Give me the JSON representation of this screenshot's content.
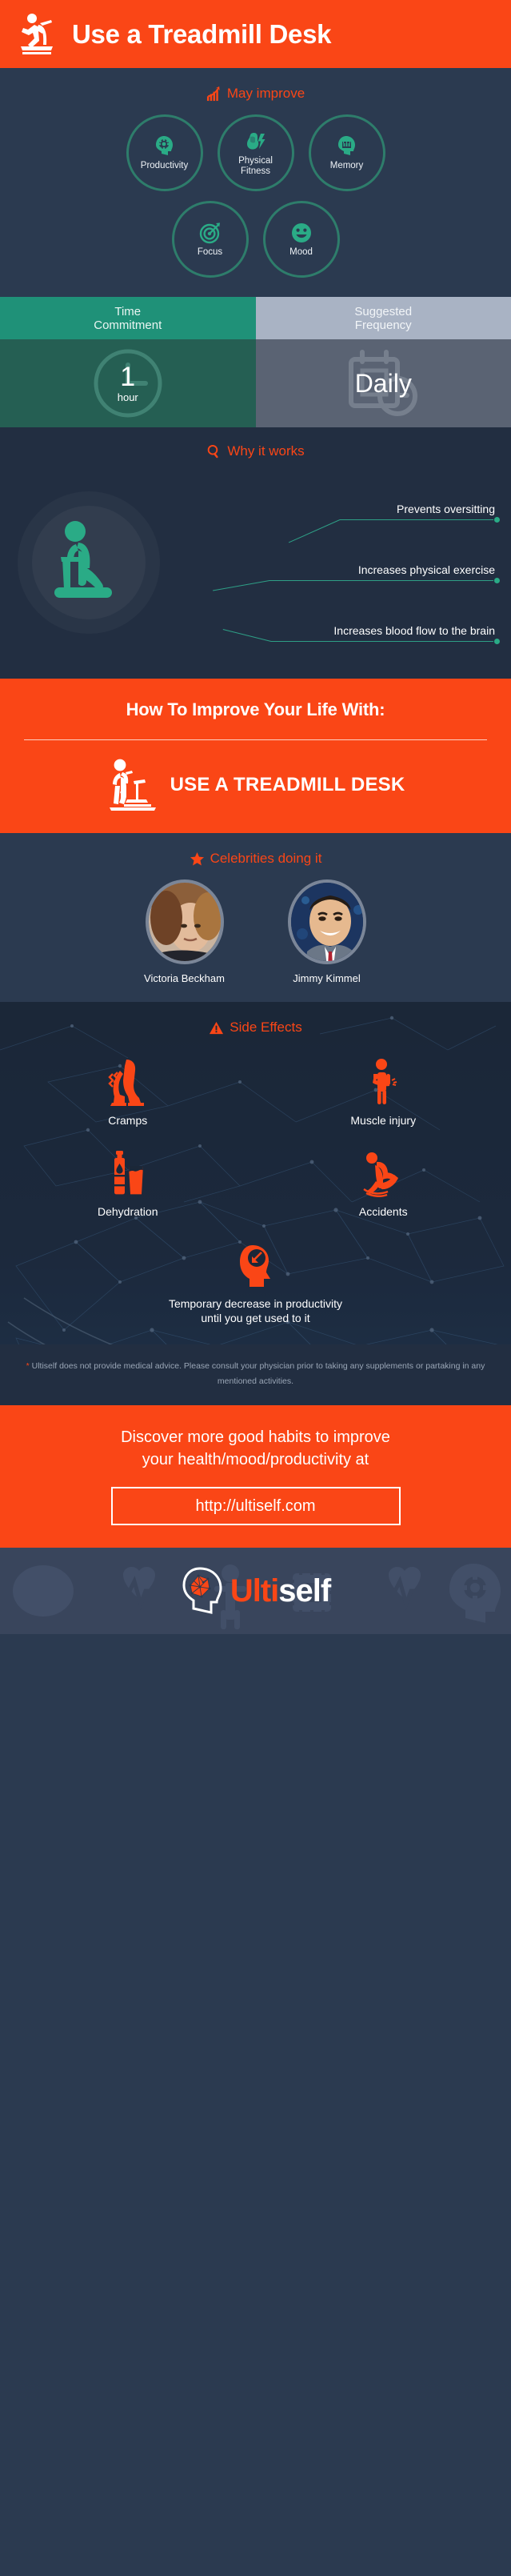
{
  "header": {
    "title": "Use a Treadmill Desk",
    "icon": "treadmill-runner-icon",
    "bg_color": "#fa4616"
  },
  "may_improve": {
    "heading": "May improve",
    "heading_icon": "rising-bar-chart-icon",
    "items": [
      {
        "label": "Productivity",
        "icon": "head-gear-icon"
      },
      {
        "label": "Physical\nFitness",
        "label_line1": "Physical",
        "label_line2": "Fitness",
        "icon": "flexed-bicep-bolt-icon"
      },
      {
        "label": "Memory",
        "icon": "head-memory-card-icon"
      },
      {
        "label": "Focus",
        "icon": "target-arrow-icon"
      },
      {
        "label": "Mood",
        "icon": "smiley-face-icon"
      }
    ],
    "circle_border_color": "#2e7d6b",
    "icon_color": "#2aab86"
  },
  "stats_table": {
    "columns": [
      {
        "header_line1": "Time",
        "header_line2": "Commitment",
        "value": "1",
        "unit": "hour",
        "bg_icon": "clock-icon",
        "header_bg": "#1f9178",
        "body_bg": "#255f53"
      },
      {
        "header_line1": "Suggested",
        "header_line2": "Frequency",
        "value": "Daily",
        "unit": "",
        "bg_icon": "calendar-clock-icon",
        "header_bg": "#a9b3c4",
        "body_bg": "#5a6373"
      }
    ]
  },
  "why_it_works": {
    "heading": "Why it works",
    "heading_icon": "magnifying-glass-icon",
    "illustration_icon": "person-on-treadmill-icon",
    "reasons": [
      "Prevents oversitting",
      "Increases physical exercise",
      "Increases blood flow to the brain"
    ],
    "line_color": "#2e9f86"
  },
  "how_to_improve": {
    "title": "How To Improve Your Life With:",
    "habit_name": "USE A TREADMILL DESK",
    "habit_icon": "treadmill-desk-walker-icon",
    "bg_color": "#fa4616"
  },
  "celebrities": {
    "heading": "Celebrities doing it",
    "heading_icon": "star-icon",
    "people": [
      {
        "name": "Victoria Beckham",
        "photo": "portrait-victoria-beckham"
      },
      {
        "name": "Jimmy Kimmel",
        "photo": "portrait-jimmy-kimmel"
      }
    ]
  },
  "side_effects": {
    "heading": "Side Effects",
    "heading_icon": "warning-triangle-icon",
    "items": [
      {
        "label": "Cramps",
        "icon": "cramping-leg-icon"
      },
      {
        "label": "Muscle injury",
        "icon": "person-holding-arm-icon"
      },
      {
        "label": "Dehydration",
        "icon": "bottle-and-glass-icon"
      },
      {
        "label": "Accidents",
        "icon": "person-slipping-icon"
      }
    ],
    "final_item": {
      "label_line1": "Temporary decrease in productivity",
      "label_line2": "until you get used to it",
      "icon": "head-down-arrow-icon"
    },
    "icon_color": "#fa4616"
  },
  "disclaimer": {
    "star": "*",
    "text": "Ultiself does not provide medical advice. Please consult your physician prior to taking any supplements or partaking in any mentioned activities."
  },
  "cta": {
    "line1": "Discover more good habits to improve",
    "line2": "your health/mood/productivity at",
    "url": "http://ultiself.com"
  },
  "footer": {
    "brand_part1": "Ulti",
    "brand_part2": "self",
    "logo_icon": "brain-head-logo-icon",
    "bg_color": "#39455c"
  }
}
